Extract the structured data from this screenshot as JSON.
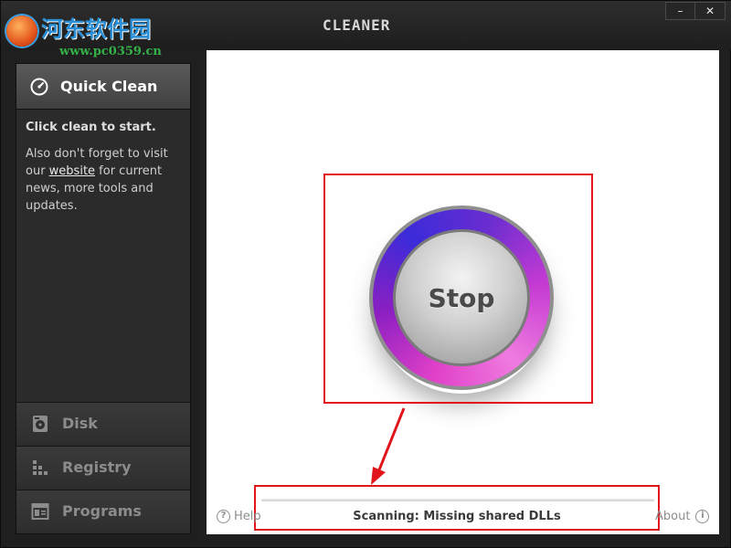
{
  "window": {
    "title": "CLEANER",
    "controls": {
      "minimize": "–",
      "close": "✕"
    }
  },
  "watermark": {
    "text": "河东软件园",
    "url": "www.pc0359.cn"
  },
  "sidebar": {
    "active": {
      "label": "Quick Clean",
      "icon": "speedometer-icon"
    },
    "intro": "Click clean to start.",
    "message": {
      "before": "Also don't forget to visit our ",
      "link": "website",
      "after": " for current news, more tools and updates."
    },
    "items": [
      {
        "label": "Disk",
        "icon": "disk-icon"
      },
      {
        "label": "Registry",
        "icon": "registry-icon"
      },
      {
        "label": "Programs",
        "icon": "programs-icon"
      }
    ]
  },
  "main": {
    "stop_button": "Stop",
    "status": "Scanning: Missing shared DLLs",
    "help": "Help",
    "about": "About"
  },
  "colors": {
    "highlight": "#e0161b",
    "ring_pink": "#e040c8",
    "ring_blue": "#3b2bd9"
  }
}
